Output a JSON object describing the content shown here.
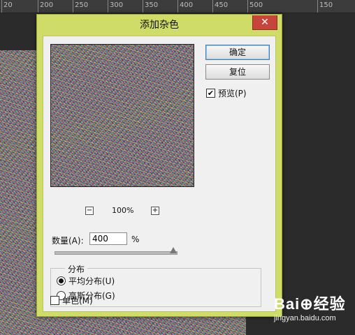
{
  "ruler": {
    "ticks": [
      "20",
      "200",
      "250",
      "300",
      "350",
      "400",
      "450",
      "500",
      "150"
    ]
  },
  "dialog": {
    "title": "添加杂色",
    "close_label": "✕",
    "buttons": {
      "ok": "确定",
      "reset": "复位"
    },
    "preview_label": "预览(P)",
    "preview_checked": true,
    "zoom": {
      "minus": "−",
      "plus": "+",
      "value": "100%"
    },
    "amount_label": "数量(A):",
    "amount_value": "400",
    "amount_unit": "%",
    "distribution": {
      "legend": "分布",
      "options": [
        {
          "label": "平均分布(U)",
          "selected": true
        },
        {
          "label": "高斯分布(G)",
          "selected": false
        }
      ]
    },
    "mono_label": "单色(M)",
    "mono_checked": false
  },
  "watermark": {
    "logo": "Bai⊕经验",
    "url": "jingyan.baidu.com"
  },
  "colors": {
    "dialog_frame": "#cfdc68",
    "close_button": "#c7463c",
    "client": "#f0f0f0"
  }
}
